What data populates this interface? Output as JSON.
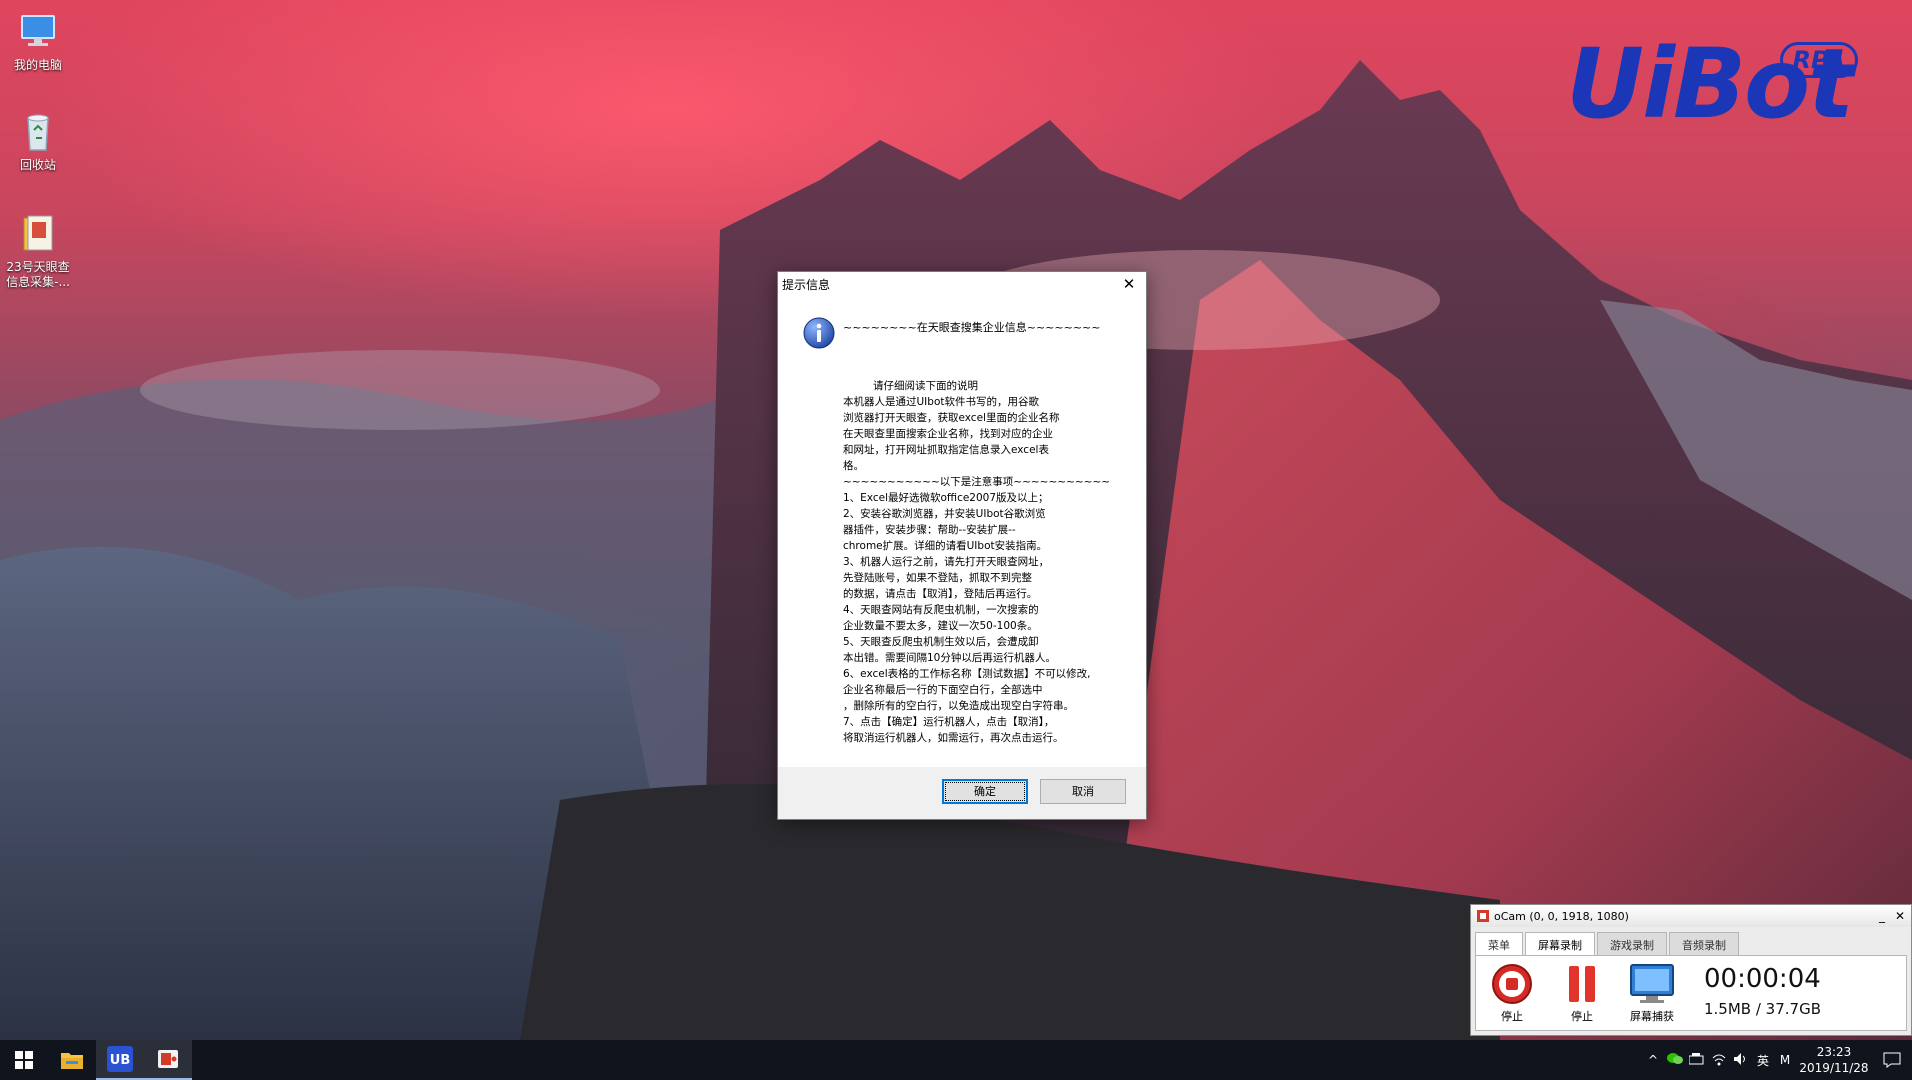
{
  "desktop": {
    "icons": [
      {
        "label": "我的电脑",
        "icon": "computer-icon"
      },
      {
        "label": "回收站",
        "icon": "recycle-bin-icon"
      },
      {
        "label_line1": "23号天眼查",
        "label_line2": "信息采集-...",
        "icon": "folder-icon"
      }
    ],
    "logo": {
      "word": "UiBot",
      "badge": "RPA",
      "color": "#1b37b8"
    }
  },
  "dialog": {
    "title": "提示信息",
    "close_symbol": "✕",
    "icon": "info-icon",
    "headline": "~~~~~~~~在天眼查搜集企业信息~~~~~~~~",
    "lines": [
      "         请仔细阅读下面的说明",
      "本机器人是通过UIbot软件书写的，用谷歌",
      "浏览器打开天眼查，获取excel里面的企业名称",
      "在天眼查里面搜索企业名称，找到对应的企业",
      "和网址，打开网址抓取指定信息录入excel表",
      "格。",
      "~~~~~~~~~~~以下是注意事项~~~~~~~~~~~",
      "1、Excel最好选微软office2007版及以上；",
      "2、安装谷歌浏览器，并安装UIbot谷歌浏览",
      "器插件，安装步骤：帮助--安装扩展--",
      "chrome扩展。详细的请看UIbot安装指南。",
      "3、机器人运行之前，请先打开天眼查网址，",
      "先登陆账号，如果不登陆，抓取不到完整",
      "的数据，请点击【取消】，登陆后再运行。",
      "4、天眼查网站有反爬虫机制，一次搜索的",
      "企业数量不要太多，建议一次50-100条。",
      "5、天眼查反爬虫机制生效以后，会遭成卸",
      "本出错。需要间隔10分钟以后再运行机器人。",
      "6、excel表格的工作标名称【测试数据】不可以修改,",
      "企业名称最后一行的下面空白行，全部选中",
      "，删除所有的空白行，以免造成出现空白字符串。",
      "7、点击【确定】运行机器人，点击【取消】，",
      "将取消运行机器人，如需运行，再次点击运行。"
    ],
    "ok_label": "确定",
    "cancel_label": "取消"
  },
  "ocam": {
    "title": "oCam (0, 0, 1918, 1080)",
    "minimize_symbol": "_",
    "close_symbol": "✕",
    "tabs": [
      "菜单",
      "屏幕录制",
      "游戏录制",
      "音频录制"
    ],
    "active_tab": "屏幕录制",
    "tools": [
      {
        "label": "停止",
        "icon": "stop-record-icon"
      },
      {
        "label": "停止",
        "icon": "pause-icon"
      },
      {
        "label": "屏幕捕获",
        "icon": "screen-capture-icon"
      }
    ],
    "timer": "00:00:04",
    "size": "1.5MB / 37.7GB"
  },
  "taskbar": {
    "apps": [
      "start-icon",
      "file-explorer-icon",
      "uibot-icon",
      "ocam-icon"
    ],
    "uibot_text": "UB",
    "tray": {
      "chevron": "^",
      "ime": "英",
      "ime2": "M",
      "time": "23:23",
      "date": "2019/11/28"
    }
  }
}
